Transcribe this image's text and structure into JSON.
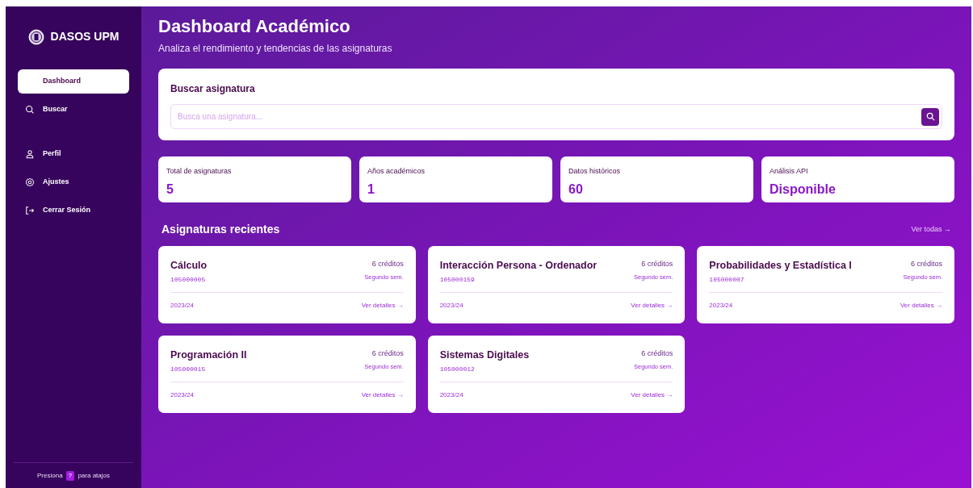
{
  "sidebar": {
    "brand": "DASOS UPM",
    "nav_main": [
      {
        "label": "Dashboard",
        "kind": "dashboard",
        "selected": true
      },
      {
        "label": "Buscar",
        "kind": "search",
        "selected": false
      }
    ],
    "nav_account": [
      {
        "label": "Perfil",
        "kind": "user",
        "selected": false
      },
      {
        "label": "Ajustes",
        "kind": "settings",
        "selected": false
      },
      {
        "label": "Cerrar Sesión",
        "kind": "logout",
        "selected": false
      }
    ],
    "footer": {
      "before": "Presiona",
      "key": "?",
      "after": "para atajos"
    }
  },
  "header": {
    "title": "Dashboard Académico",
    "subtitle": "Analiza el rendimiento y tendencias de las asignaturas"
  },
  "search": {
    "title": "Buscar asignatura",
    "placeholder": "Busca una asignatura..."
  },
  "stats": [
    {
      "label": "Total de asignaturas",
      "value": "5"
    },
    {
      "label": "Años académicos",
      "value": "1"
    },
    {
      "label": "Datos históricos",
      "value": "60"
    },
    {
      "label": "Análisis API",
      "value": "Disponible"
    }
  ],
  "recent": {
    "title": "Asignaturas recientes",
    "see_all": "Ver todas →",
    "courses": [
      {
        "name": "Cálculo",
        "code": "105000005",
        "credits": "6 créditos",
        "semester": "Segundo sem.",
        "year": "2023/24",
        "link": "Ver detalles →"
      },
      {
        "name": "Interacción Persona - Ordenador",
        "code": "105000159",
        "credits": "6 créditos",
        "semester": "Segundo sem.",
        "year": "2023/24",
        "link": "Ver detalles →"
      },
      {
        "name": "Probabilidades y Estadística I",
        "code": "105000007",
        "credits": "6 créditos",
        "semester": "Segundo sem.",
        "year": "2023/24",
        "link": "Ver detalles →"
      },
      {
        "name": "Programación II",
        "code": "105000015",
        "credits": "6 créditos",
        "semester": "Segundo sem.",
        "year": "2023/24",
        "link": "Ver detalles →"
      },
      {
        "name": "Sistemas Digitales",
        "code": "105000012",
        "credits": "6 créditos",
        "semester": "Segundo sem.",
        "year": "2023/24",
        "link": "Ver detalles →"
      }
    ]
  }
}
